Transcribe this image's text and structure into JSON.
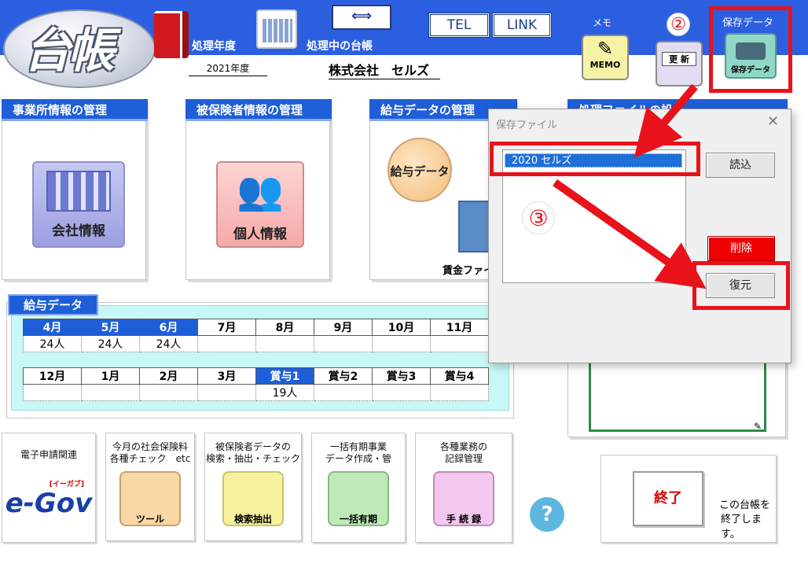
{
  "header": {
    "logo_text": "台帳",
    "fiscal_year_label": "処理年度",
    "fiscal_year_value": "2021年度",
    "current_ledger_label": "処理中の台帳",
    "company_name": "株式会社　セルズ",
    "switch_arrows": "⟺",
    "tel_label": "TEL",
    "link_label": "LINK",
    "memo_caption": "メモ",
    "memo_icon_label": "MEMO",
    "update_icon_label": "更 新",
    "save_caption": "保存データ",
    "save_icon_label": "保存データ",
    "step2_marker": "②"
  },
  "panels": {
    "office": {
      "title": "事業所情報の管理",
      "button": "会社情報"
    },
    "insured": {
      "title": "被保険者情報の管理",
      "button": "個人情報"
    },
    "salary": {
      "title": "給与データの管理",
      "button": "給与データ",
      "sub_button": "賃金ファイ"
    },
    "processing": {
      "title": "処理ファイルの設"
    }
  },
  "salary_section": {
    "title": "給与データ",
    "row1_months": [
      "4月",
      "5月",
      "6月",
      "7月",
      "8月",
      "9月",
      "10月",
      "11月"
    ],
    "row1_counts": [
      "24人",
      "24人",
      "24人",
      "",
      "",
      "",
      "",
      ""
    ],
    "row1_active": [
      true,
      true,
      true,
      false,
      false,
      false,
      false,
      false
    ],
    "row2_months": [
      "12月",
      "1月",
      "2月",
      "3月",
      "賞与1",
      "賞与2",
      "賞与3",
      "賞与4"
    ],
    "row2_counts": [
      "",
      "",
      "",
      "",
      "19人",
      "",
      "",
      ""
    ],
    "row2_active": [
      false,
      false,
      false,
      false,
      true,
      false,
      false,
      false
    ]
  },
  "dialog": {
    "title": "保存ファイル",
    "close": "✕",
    "list_items": [
      "2020 セルズ"
    ],
    "selected_item": "2020 セルズ",
    "load_button": "読込",
    "delete_button": "削除",
    "restore_button": "復元",
    "step3_marker": "③"
  },
  "bottom": {
    "egov": {
      "caption": "電子申請関連",
      "logo": "e-Gov",
      "tag": "[イーガブ]"
    },
    "tools": {
      "caption_line1": "今月の社会保険料",
      "caption_line2": "各種チェック　etc",
      "icon_label": "ツール"
    },
    "search": {
      "caption_line1": "被保険者データの",
      "caption_line2": "検索・抽出・チェック",
      "icon_label": "検索抽出"
    },
    "bulk": {
      "caption_line1": "一括有期事業",
      "caption_line2": "データ作成・管",
      "icon_label": "一括有期"
    },
    "records": {
      "caption_line1": "各種業務の",
      "caption_line2": "記録管理",
      "icon_label": "手 続 録"
    },
    "help": "?",
    "exit_button": "終了",
    "exit_desc_line1": "この台帳を",
    "exit_desc_line2": "終了します。"
  },
  "colors": {
    "brand_blue": "#1e5ed8",
    "highlight_red": "#e8121a",
    "exit_red": "#d40000"
  }
}
